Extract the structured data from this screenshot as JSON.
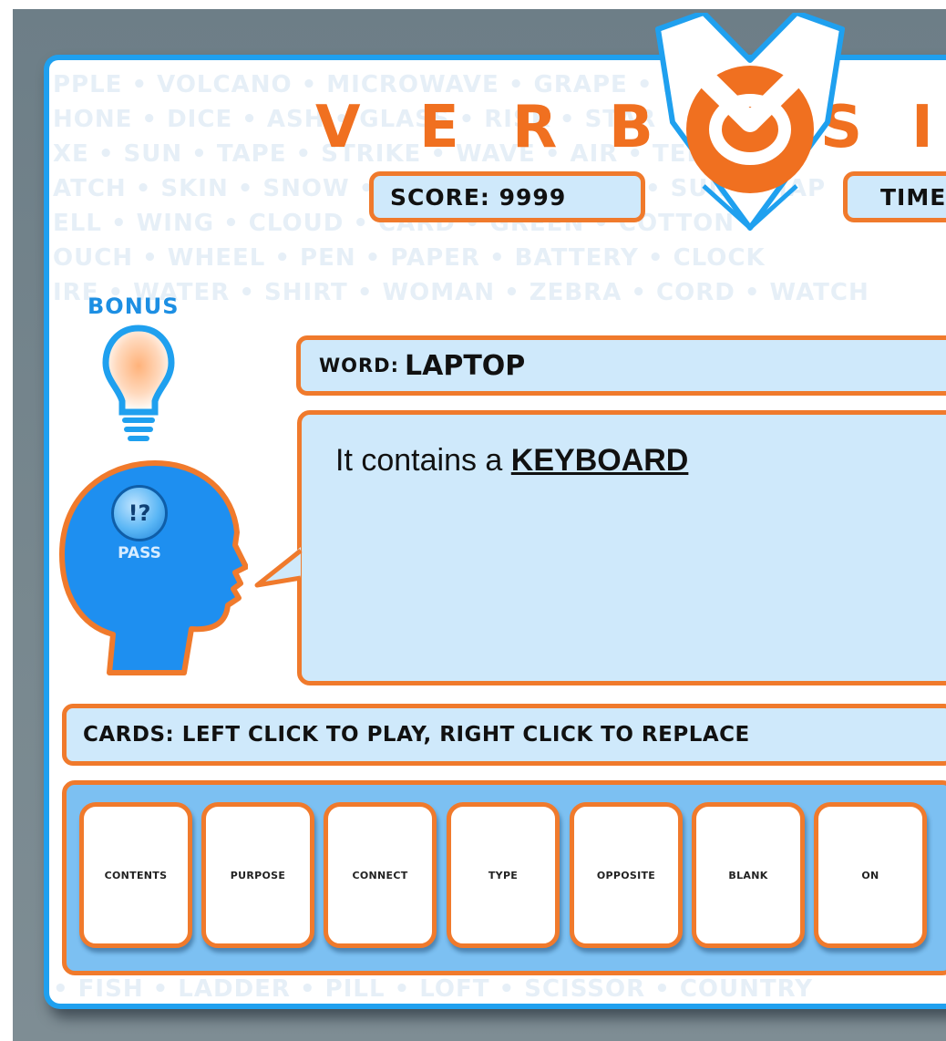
{
  "title": {
    "letters": [
      "V",
      "E",
      "R",
      "B",
      "S",
      "I"
    ],
    "logo_letter": "O"
  },
  "hud": {
    "score": "SCORE: 9999",
    "time": "TIME"
  },
  "bonus": {
    "label": "BONUS"
  },
  "pass": {
    "symbol": "!?",
    "label": "PASS"
  },
  "word": {
    "key": "WORD:",
    "value": "LAPTOP"
  },
  "clue": {
    "prefix": "It contains a ",
    "keyword": "KEYBOARD"
  },
  "cards": {
    "instructions": "CARDS: LEFT CLICK TO PLAY, RIGHT CLICK TO REPLACE",
    "items": [
      "CONTENTS",
      "PURPOSE",
      "CONNECT",
      "TYPE",
      "OPPOSITE",
      "BLANK",
      "ON"
    ]
  },
  "word_wall": [
    "PPLE • VOLCANO • MICROWAVE • GRAPE • BEE • P",
    "HONE • DICE • ASH • GLASS • RISK • STAR • METAL •",
    "XE • SUN • TAPE • STRIKE • WAVE • AIR • TEETH",
    "ATCH • SKIN • SNOW • BANANA • LEMON • SUN • MAP",
    "ELL • WING • CLOUD • CARD • GREEN • COTTON",
    "OUCH • WHEEL • PEN • PAPER • BATTERY • CLOCK",
    "IRE • WATER • SHIRT • WOMAN • ZEBRA • CORD • WATCH",
    "• FISH • LADDER • PILL • LOFT • SCISSOR • COUNTRY"
  ],
  "colors": {
    "accent": "#f07a2c",
    "frame": "#1fa0ef",
    "panel": "#cfe9fb",
    "tray": "#7cc0f2"
  }
}
